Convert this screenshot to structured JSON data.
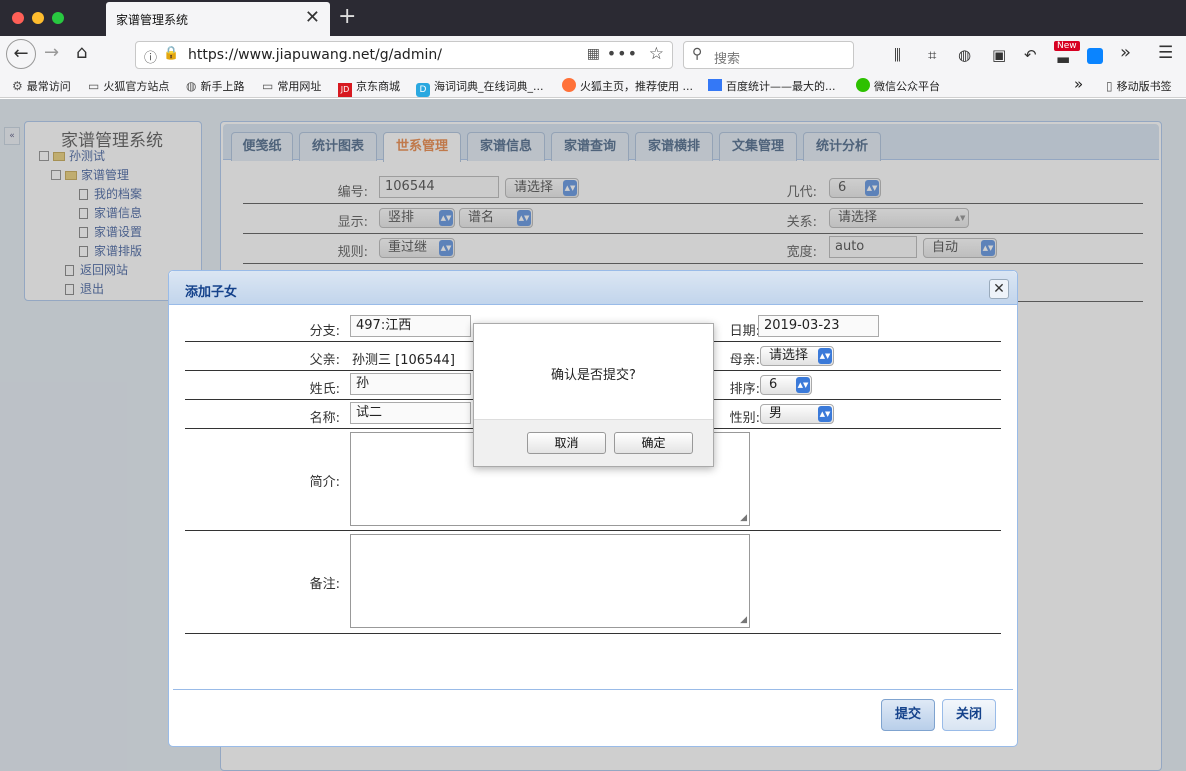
{
  "browser": {
    "tab_title": "家谱管理系统",
    "url": "https://www.jiapuwang.net/g/admin/",
    "search_placeholder": "搜索",
    "new_badge": "New",
    "bookmarks": [
      "最常访问",
      "火狐官方站点",
      "新手上路",
      "常用网址",
      "京东商城",
      "海词词典_在线词典_...",
      "火狐主页，推荐使用 ...",
      "百度统计——最大的...",
      "微信公众平台"
    ],
    "bookmarks_more": "»",
    "mobile_bookmarks": "移动版书签"
  },
  "sidebar": {
    "title": "家谱管理系统",
    "root": "孙测试",
    "group": "家谱管理",
    "items": [
      "我的档案",
      "家谱信息",
      "家谱设置",
      "家谱排版"
    ],
    "back": "返回网站",
    "logout": "退出"
  },
  "tabs": [
    "便笺纸",
    "统计图表",
    "世系管理",
    "家谱信息",
    "家谱查询",
    "家谱横排",
    "文集管理",
    "统计分析"
  ],
  "form": {
    "number_label": "编号:",
    "number_value": "106544",
    "number_select": "请选择",
    "gen_label": "几代:",
    "gen_value": "6",
    "display_label": "显示:",
    "display_value": "竖排",
    "display_select2": "谱名",
    "relation_label": "关系:",
    "relation_value": "请选择",
    "rule_label": "规则:",
    "rule_value": "重过继",
    "width_label": "宽度:",
    "width_value": "auto",
    "width_select": "自动"
  },
  "dialog": {
    "title": "添加子女",
    "branch_label": "分支:",
    "branch_value": "497:江西",
    "date_label": "日期:",
    "date_value": "2019-03-23",
    "father_label": "父亲:",
    "father_value": "孙测三 [106544]",
    "mother_label": "母亲:",
    "mother_value": "请选择",
    "surname_label": "姓氏:",
    "surname_value": "孙",
    "order_label": "排序:",
    "order_value": "6",
    "name_label": "名称:",
    "name_value": "试二",
    "gender_label": "性别:",
    "gender_value": "男",
    "intro_label": "简介:",
    "remark_label": "备注:",
    "submit": "提交",
    "close": "关闭"
  },
  "confirm": {
    "message": "确认是否提交?",
    "cancel": "取消",
    "ok": "确定"
  }
}
